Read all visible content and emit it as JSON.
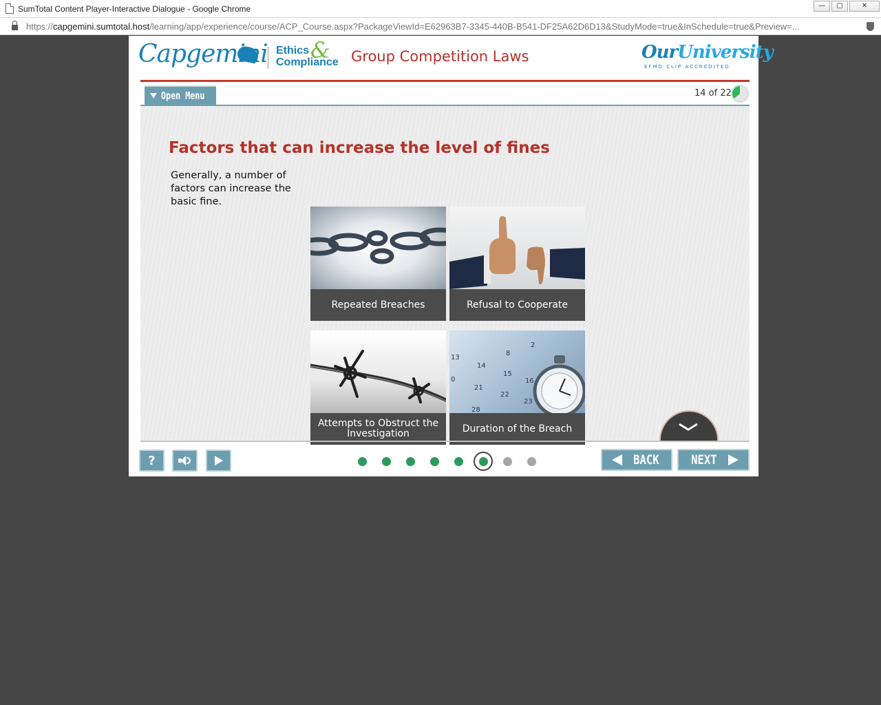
{
  "window": {
    "title": "SumTotal Content Player-Interactive Dialogue - Google Chrome",
    "controls": {
      "minimize": "—",
      "restore": "▢",
      "close": "✕"
    }
  },
  "address_bar": {
    "url_prefix": "https://",
    "url_host": "capgemini.sumtotal.host",
    "url_path": "/learning/app/experience/course/ACP_Course.aspx?PackageViewId=E62963B7-3345-440B-B541-DF25A62D6D13&StudyMode=true&InSchedule=true&Preview=..."
  },
  "header": {
    "brand": "Capgemini",
    "ethics_line1": "Ethics",
    "ethics_amp": "&",
    "ethics_line2": "Compliance",
    "course_title": "Group Competition Laws",
    "university_our": "Our",
    "university_name": "University",
    "university_tag": "EFMD CLIP ACCREDITED"
  },
  "menu": {
    "open_menu_label": "Open Menu",
    "page_counter": "14 of 22",
    "progress_fraction": 0.36
  },
  "slide": {
    "title": "Factors that can increase the level of fines",
    "intro": "Generally, a number of factors can increase the basic fine.",
    "tiles": [
      {
        "label": "Repeated Breaches",
        "image": "chain-icon"
      },
      {
        "label": "Refusal to Cooperate",
        "image": "thumbs-up-down-icon"
      },
      {
        "label": "Attempts to Obstruct the Investigation",
        "image": "barbed-wire-icon"
      },
      {
        "label": "Duration of the Breach",
        "image": "stopwatch-calendar-icon"
      }
    ]
  },
  "footer": {
    "help_label": "?",
    "back_label": "BACK",
    "next_label": "NEXT",
    "progress_dots": [
      "done",
      "done",
      "done",
      "done",
      "done",
      "current",
      "todo",
      "todo"
    ]
  },
  "colors": {
    "accent_red": "#b5322a",
    "brand_blue": "#1a81b7",
    "control_teal": "#6d9eb0",
    "dot_green": "#2c9a5e",
    "caption_bg": "#4b4b4b"
  }
}
